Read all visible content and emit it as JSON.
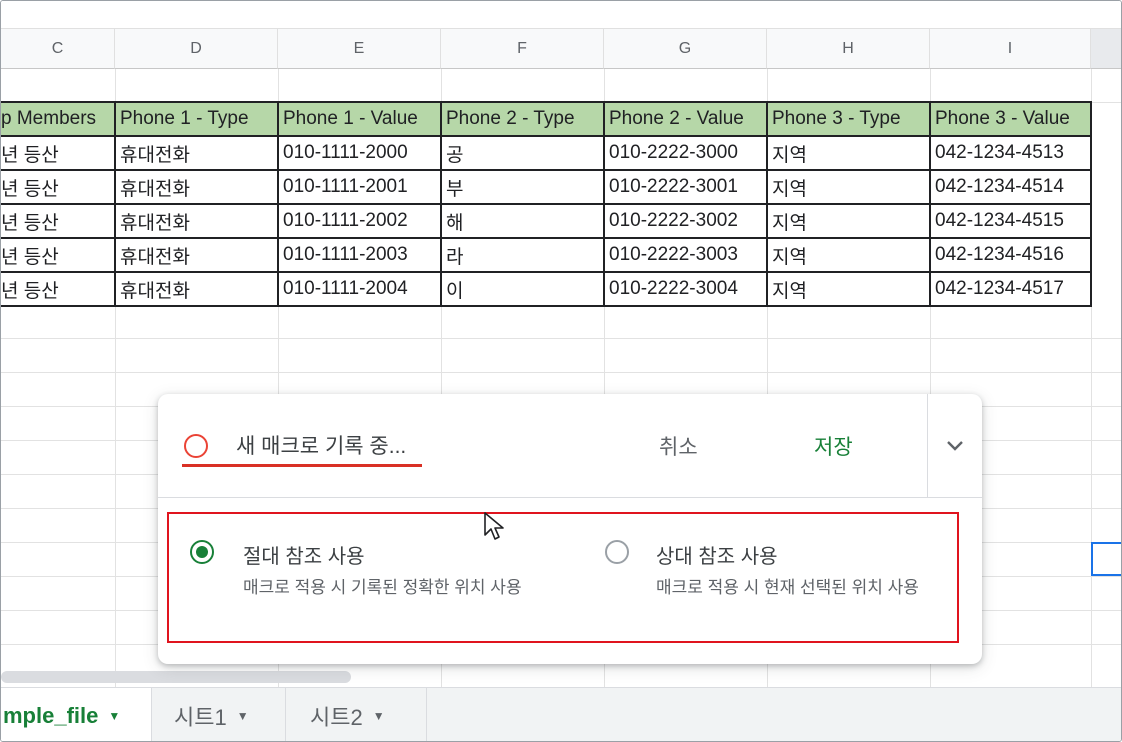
{
  "columns": [
    {
      "letter": "C"
    },
    {
      "letter": "D"
    },
    {
      "letter": "E"
    },
    {
      "letter": "F"
    },
    {
      "letter": "G"
    },
    {
      "letter": "H"
    },
    {
      "letter": "I"
    }
  ],
  "table": {
    "headers": [
      "p Members",
      "Phone 1 - Type",
      "Phone 1 - Value",
      "Phone 2 - Type",
      "Phone 2 - Value",
      "Phone 3 - Type",
      "Phone 3 - Value"
    ],
    "rows": [
      [
        "년 등산",
        "휴대전화",
        "010-1111-2000",
        "공",
        "010-2222-3000",
        "지역",
        "042-1234-4513"
      ],
      [
        "년 등산",
        "휴대전화",
        "010-1111-2001",
        "부",
        "010-2222-3001",
        "지역",
        "042-1234-4514"
      ],
      [
        "년 등산",
        "휴대전화",
        "010-1111-2002",
        "해",
        "010-2222-3002",
        "지역",
        "042-1234-4515"
      ],
      [
        "년 등산",
        "휴대전화",
        "010-1111-2003",
        "라",
        "010-2222-3003",
        "지역",
        "042-1234-4516"
      ],
      [
        "년 등산",
        "휴대전화",
        "010-1111-2004",
        "이",
        "010-2222-3004",
        "지역",
        "042-1234-4517"
      ]
    ],
    "header_color": "#b6d7a8"
  },
  "macro_dialog": {
    "title": "새 매크로 기록 중...",
    "cancel_label": "취소",
    "save_label": "저장",
    "expand_icon": "chevron-down-icon",
    "record_icon": "record-circle-icon",
    "options": [
      {
        "title": "절대 참조 사용",
        "description": "매크로 적용 시 기록된 정확한 위치 사용",
        "selected": true
      },
      {
        "title": "상대 참조 사용",
        "description": "매크로 적용 시 현재 선택된 위치 사용",
        "selected": false
      }
    ],
    "accent_color": "#188038",
    "record_color": "#ea4335",
    "highlight_border_color": "#e0141e"
  },
  "sheet_tabs": [
    {
      "label": "mple_file",
      "active": true
    },
    {
      "label": "시트1",
      "active": false
    },
    {
      "label": "시트2",
      "active": false
    }
  ]
}
